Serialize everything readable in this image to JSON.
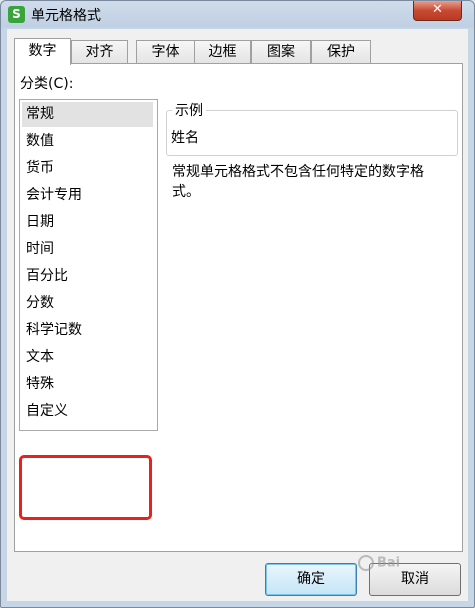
{
  "window": {
    "title": "单元格格式",
    "app_icon_letter": "S"
  },
  "tabs": [
    {
      "label": "数字",
      "active": true
    },
    {
      "label": "对齐",
      "active": false
    },
    {
      "label": "字体",
      "active": false
    },
    {
      "label": "边框",
      "active": false
    },
    {
      "label": "图案",
      "active": false
    },
    {
      "label": "保护",
      "active": false
    }
  ],
  "category": {
    "label": "分类(C):",
    "items": [
      "常规",
      "数值",
      "货币",
      "会计专用",
      "日期",
      "时间",
      "百分比",
      "分数",
      "科学记数",
      "文本",
      "特殊",
      "自定义"
    ],
    "selected": "常规"
  },
  "sample": {
    "legend": "示例",
    "value": "姓名"
  },
  "description": "常规单元格格式不包含任何特定的数字格式。",
  "buttons": {
    "ok": "确定",
    "cancel": "取消"
  },
  "highlight": {
    "color": "#e8201e",
    "target": "自定义"
  },
  "watermark": {
    "text": "Bai"
  }
}
